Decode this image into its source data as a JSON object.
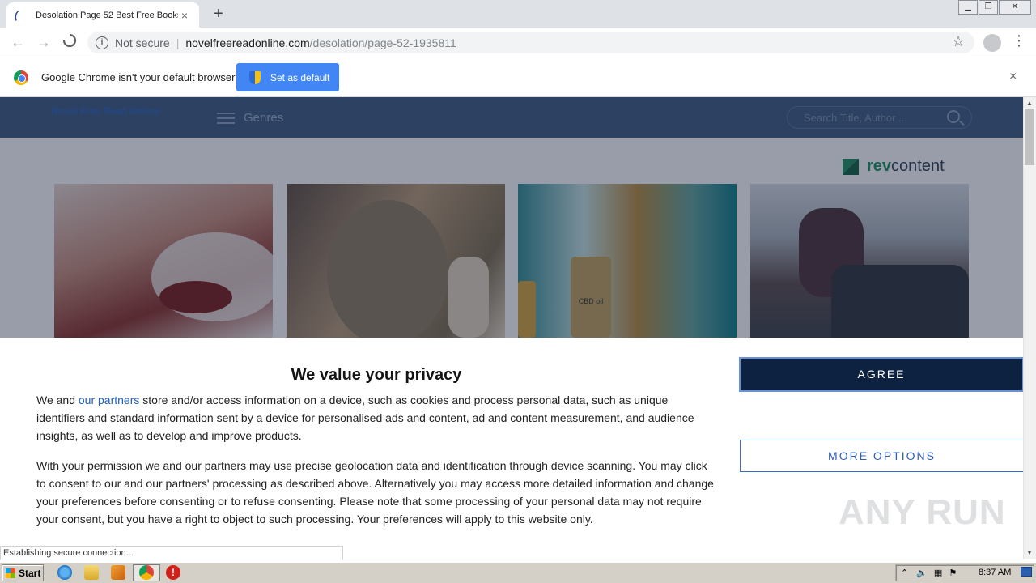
{
  "browser": {
    "tab_title": "Desolation Page 52 Best Free Books",
    "tab_close": "×",
    "new_tab": "+",
    "security_label": "Not secure",
    "url_host": "novelfreereadonline.com",
    "url_path": "/desolation/page-52-1935811",
    "reload_state": "loading"
  },
  "infobar": {
    "message": "Google Chrome isn't your default browser",
    "button_label": "Set as default",
    "close": "×"
  },
  "site": {
    "logo_text": "Novel Free Read Online",
    "menu_label": "Genres",
    "search_placeholder": "Search Title, Author ..."
  },
  "ads": {
    "network": "revcontent",
    "network_part1": "rev",
    "network_part2": "content",
    "cbd_label": "CBD oil"
  },
  "consent": {
    "title": "We value your privacy",
    "p1_before": "We and ",
    "p1_link": "our partners",
    "p1_after": " store and/or access information on a device, such as cookies and process personal data, such as unique identifiers and standard information sent by a device for personalised ads and content, ad and content measurement, and audience insights, as well as to develop and improve products.",
    "p2": "With your permission we and our partners may use precise geolocation data and identification through device scanning. You may click to consent to our and our partners' processing as described above. Alternatively you may access more detailed information and change your preferences before consenting or to refuse consenting. Please note that some processing of your personal data may not require your consent, but you have a right to object to such processing. Your preferences will apply to this website only.",
    "agree_label": "AGREE",
    "more_label": "MORE OPTIONS"
  },
  "status_text": "Establishing secure connection...",
  "watermark": "ANY RUN",
  "taskbar": {
    "start_label": "Start",
    "clock": "8:37 AM"
  },
  "colors": {
    "site_header": "#3c5a80",
    "agree_bg": "#0d2240",
    "chrome_blue": "#4285f4",
    "revcontent_green": "#1a8f5c"
  }
}
